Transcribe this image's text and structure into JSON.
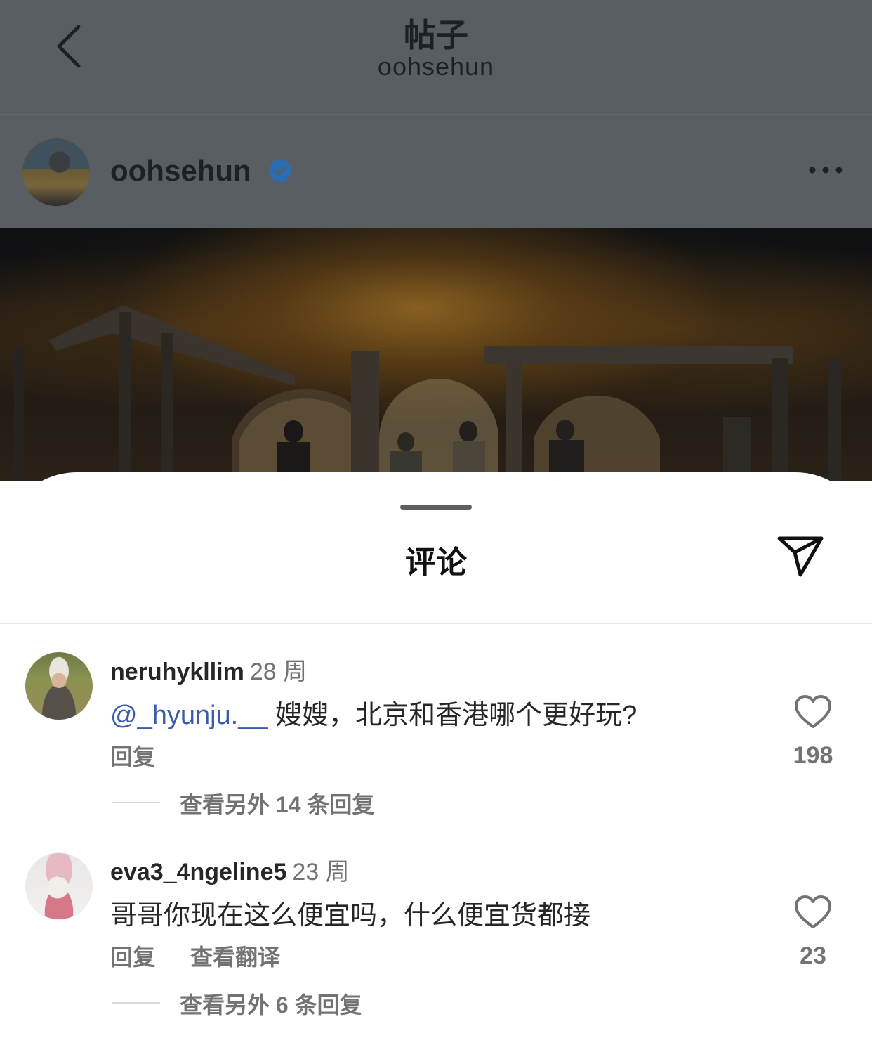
{
  "header": {
    "title": "帖子",
    "subtitle": "oohsehun",
    "back_icon": "chevron-left-icon"
  },
  "post": {
    "author": "oohsehun",
    "verified": true,
    "verified_color": "#2a6db0",
    "more_icon": "ellipsis-icon"
  },
  "sheet": {
    "title": "评论",
    "share_icon": "paper-plane-icon"
  },
  "comments": [
    {
      "username": "neruhykllim",
      "time": "28 周",
      "mention": "@_hyunju.__",
      "text": "嫂嫂，北京和香港哪个更好玩?",
      "reply_label": "回复",
      "likes": "198",
      "view_replies": "查看另外 14 条回复"
    },
    {
      "username": "eva3_4ngeline5",
      "time": "23 周",
      "text": "哥哥你现在这么便宜吗，什么便宜货都接",
      "reply_label": "回复",
      "translate_label": "查看翻译",
      "likes": "23",
      "view_replies": "查看另外 6 条回复"
    }
  ],
  "colors": {
    "mention": "#3b5ab0",
    "secondary_text": "#737373",
    "dim_overlay": "#595e63"
  }
}
